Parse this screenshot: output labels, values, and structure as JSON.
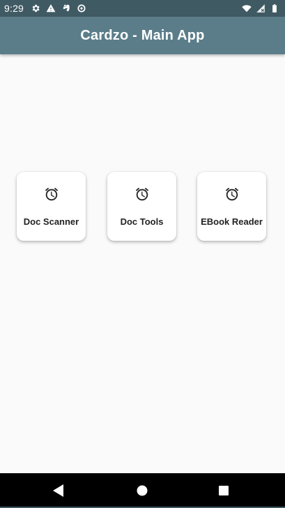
{
  "status_bar": {
    "time": "9:29",
    "left_icons": [
      "settings-icon",
      "warning-icon",
      "evernote-icon",
      "data-saver-icon"
    ],
    "right_icons": [
      "wifi-icon",
      "no-signal-icon",
      "battery-icon"
    ]
  },
  "app_bar": {
    "title": "Cardzo - Main App",
    "color": "#5b7d8a"
  },
  "cards": [
    {
      "label": "Doc Scanner",
      "icon": "alarm-clock-icon"
    },
    {
      "label": "Doc Tools",
      "icon": "alarm-clock-icon"
    },
    {
      "label": "EBook Reader",
      "icon": "alarm-clock-icon"
    }
  ],
  "nav_bar": {
    "buttons": [
      "back-icon",
      "home-icon",
      "recents-icon"
    ]
  },
  "colors": {
    "status_bar": "#405a64",
    "background": "#fafafa",
    "card": "#ffffff",
    "nav_bar": "#000000"
  }
}
